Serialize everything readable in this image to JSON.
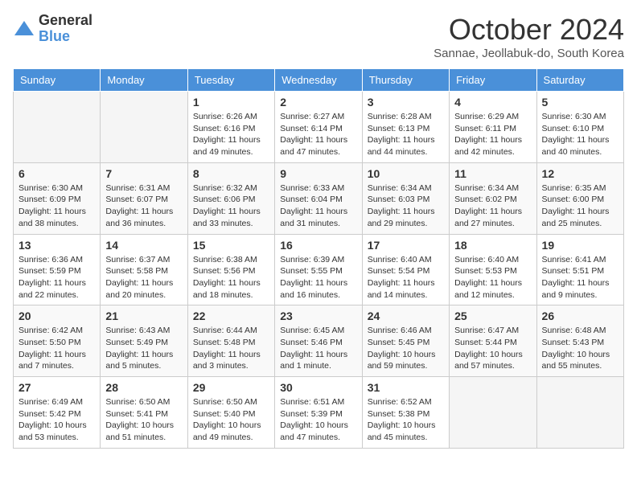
{
  "header": {
    "logo": {
      "general": "General",
      "blue": "Blue"
    },
    "title": "October 2024",
    "subtitle": "Sannae, Jeollabuk-do, South Korea"
  },
  "days_of_week": [
    "Sunday",
    "Monday",
    "Tuesday",
    "Wednesday",
    "Thursday",
    "Friday",
    "Saturday"
  ],
  "weeks": [
    [
      {
        "day": "",
        "empty": true
      },
      {
        "day": "",
        "empty": true
      },
      {
        "day": "1",
        "sunrise": "6:26 AM",
        "sunset": "6:16 PM",
        "daylight": "11 hours and 49 minutes."
      },
      {
        "day": "2",
        "sunrise": "6:27 AM",
        "sunset": "6:14 PM",
        "daylight": "11 hours and 47 minutes."
      },
      {
        "day": "3",
        "sunrise": "6:28 AM",
        "sunset": "6:13 PM",
        "daylight": "11 hours and 44 minutes."
      },
      {
        "day": "4",
        "sunrise": "6:29 AM",
        "sunset": "6:11 PM",
        "daylight": "11 hours and 42 minutes."
      },
      {
        "day": "5",
        "sunrise": "6:30 AM",
        "sunset": "6:10 PM",
        "daylight": "11 hours and 40 minutes."
      }
    ],
    [
      {
        "day": "6",
        "sunrise": "6:30 AM",
        "sunset": "6:09 PM",
        "daylight": "11 hours and 38 minutes."
      },
      {
        "day": "7",
        "sunrise": "6:31 AM",
        "sunset": "6:07 PM",
        "daylight": "11 hours and 36 minutes."
      },
      {
        "day": "8",
        "sunrise": "6:32 AM",
        "sunset": "6:06 PM",
        "daylight": "11 hours and 33 minutes."
      },
      {
        "day": "9",
        "sunrise": "6:33 AM",
        "sunset": "6:04 PM",
        "daylight": "11 hours and 31 minutes."
      },
      {
        "day": "10",
        "sunrise": "6:34 AM",
        "sunset": "6:03 PM",
        "daylight": "11 hours and 29 minutes."
      },
      {
        "day": "11",
        "sunrise": "6:34 AM",
        "sunset": "6:02 PM",
        "daylight": "11 hours and 27 minutes."
      },
      {
        "day": "12",
        "sunrise": "6:35 AM",
        "sunset": "6:00 PM",
        "daylight": "11 hours and 25 minutes."
      }
    ],
    [
      {
        "day": "13",
        "sunrise": "6:36 AM",
        "sunset": "5:59 PM",
        "daylight": "11 hours and 22 minutes."
      },
      {
        "day": "14",
        "sunrise": "6:37 AM",
        "sunset": "5:58 PM",
        "daylight": "11 hours and 20 minutes."
      },
      {
        "day": "15",
        "sunrise": "6:38 AM",
        "sunset": "5:56 PM",
        "daylight": "11 hours and 18 minutes."
      },
      {
        "day": "16",
        "sunrise": "6:39 AM",
        "sunset": "5:55 PM",
        "daylight": "11 hours and 16 minutes."
      },
      {
        "day": "17",
        "sunrise": "6:40 AM",
        "sunset": "5:54 PM",
        "daylight": "11 hours and 14 minutes."
      },
      {
        "day": "18",
        "sunrise": "6:40 AM",
        "sunset": "5:53 PM",
        "daylight": "11 hours and 12 minutes."
      },
      {
        "day": "19",
        "sunrise": "6:41 AM",
        "sunset": "5:51 PM",
        "daylight": "11 hours and 9 minutes."
      }
    ],
    [
      {
        "day": "20",
        "sunrise": "6:42 AM",
        "sunset": "5:50 PM",
        "daylight": "11 hours and 7 minutes."
      },
      {
        "day": "21",
        "sunrise": "6:43 AM",
        "sunset": "5:49 PM",
        "daylight": "11 hours and 5 minutes."
      },
      {
        "day": "22",
        "sunrise": "6:44 AM",
        "sunset": "5:48 PM",
        "daylight": "11 hours and 3 minutes."
      },
      {
        "day": "23",
        "sunrise": "6:45 AM",
        "sunset": "5:46 PM",
        "daylight": "11 hours and 1 minute."
      },
      {
        "day": "24",
        "sunrise": "6:46 AM",
        "sunset": "5:45 PM",
        "daylight": "10 hours and 59 minutes."
      },
      {
        "day": "25",
        "sunrise": "6:47 AM",
        "sunset": "5:44 PM",
        "daylight": "10 hours and 57 minutes."
      },
      {
        "day": "26",
        "sunrise": "6:48 AM",
        "sunset": "5:43 PM",
        "daylight": "10 hours and 55 minutes."
      }
    ],
    [
      {
        "day": "27",
        "sunrise": "6:49 AM",
        "sunset": "5:42 PM",
        "daylight": "10 hours and 53 minutes."
      },
      {
        "day": "28",
        "sunrise": "6:50 AM",
        "sunset": "5:41 PM",
        "daylight": "10 hours and 51 minutes."
      },
      {
        "day": "29",
        "sunrise": "6:50 AM",
        "sunset": "5:40 PM",
        "daylight": "10 hours and 49 minutes."
      },
      {
        "day": "30",
        "sunrise": "6:51 AM",
        "sunset": "5:39 PM",
        "daylight": "10 hours and 47 minutes."
      },
      {
        "day": "31",
        "sunrise": "6:52 AM",
        "sunset": "5:38 PM",
        "daylight": "10 hours and 45 minutes."
      },
      {
        "day": "",
        "empty": true
      },
      {
        "day": "",
        "empty": true
      }
    ]
  ],
  "labels": {
    "sunrise_prefix": "Sunrise: ",
    "sunset_prefix": "Sunset: ",
    "daylight_prefix": "Daylight: "
  }
}
